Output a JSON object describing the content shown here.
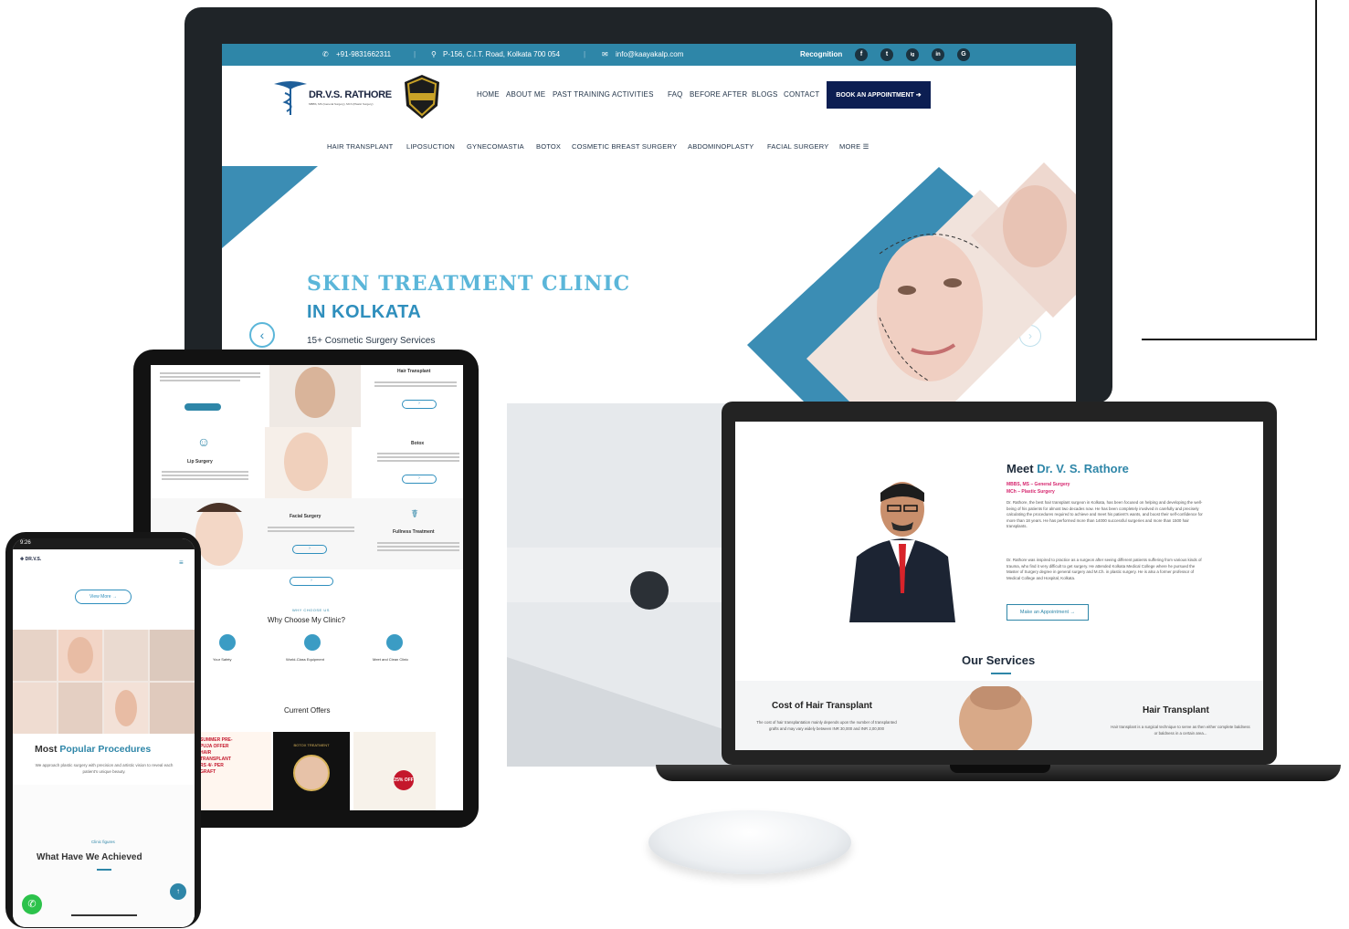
{
  "desktop": {
    "topbar": {
      "phone": "+91-9831662311",
      "address": "P-156, C.I.T. Road, Kolkata 700 054",
      "email": "info@kaayakalp.com",
      "recognition": "Recognition",
      "social": [
        "f",
        "t",
        "ig",
        "in",
        "G"
      ]
    },
    "logo": {
      "name": "DR.V.S. RATHORE",
      "tagline": "MBBS, MS (General Surgery), MCh (Plastic Surgery)"
    },
    "nav_primary": [
      "HOME",
      "ABOUT ME",
      "PAST TRAINING ACTIVITIES",
      "FAQ",
      "BEFORE AFTER",
      "BLOGS",
      "CONTACT"
    ],
    "book_button": "BOOK AN APPOINTMENT ➔",
    "nav_secondary": [
      "HAIR TRANSPLANT",
      "LIPOSUCTION",
      "GYNECOMASTIA",
      "BOTOX",
      "COSMETIC BREAST SURGERY",
      "ABDOMINOPLASTY",
      "FACIAL SURGERY",
      "MORE ☰"
    ],
    "hero": {
      "title_line1": "SKIN TREATMENT CLINIC",
      "title_line2": "IN KOLKATA",
      "subtitle": "15+ Cosmetic Surgery Services"
    },
    "accent": "#2e86a8"
  },
  "laptop": {
    "meet_prefix": "Meet ",
    "meet_name": "Dr. V. S. Rathore",
    "qual1": "MBBS, MS – General Surgery",
    "qual2": "MCh – Plastic Surgery",
    "bio1": "Dr. Rathore, the best hair transplant surgeon in Kolkata, has been focused on helping and developing the well-being of his patients for almost two decades now. He has been completely involved in carefully and precisely calculating the procedures required to achieve and meet his patient's wants, and boost their self-confidence for more than 18 years. He has performed more than 14000 successful surgeries and more than 1500 hair transplants.",
    "bio2": "Dr. Rathore was inspired to practice as a surgeon after seeing different patients suffering from various kinds of trauma, who find it very difficult to get surgery. He attended Kolkata Medical College where he pursued the Master of Surgery degree in general surgery and M.Ch. in plastic surgery. He is also a former professor of Medical College and Hospital, Kolkata.",
    "appointment_button": "Make an Appointment →",
    "services_heading": "Our Services",
    "service1_title": "Cost of Hair Transplant",
    "service1_text": "The cost of hair transplantation mainly depends upon the number of transplanted grafts and may vary widely between INR 30,000 and INR 2,00,000",
    "service2_title": "Hair Transplant",
    "service2_text": "Hair transplant is a surgical technique to serve as then either complete baldness or baldness in a certain area..."
  },
  "tablet": {
    "card1_title": "Hair Transplant",
    "card2_title": "Lip Surgery",
    "card3_title": "Botox",
    "card4_title": "Facial Surgery",
    "card5_title": "Fullness Treatment",
    "why_kicker": "WHY CHOOSE US",
    "why_heading": "Why Choose My Clinic?",
    "why_items": [
      "Your Safety",
      "World-Class Equipment",
      "Meet and Clean Clinic"
    ],
    "offers_heading": "Current Offers",
    "offer1_text": "SUMMER PRE-PUJA OFFER HAIR TRANSPLANT RS 4/- PER GRAFT",
    "offer2_text": "BOTOX TREATMENT",
    "offer3_text": "25% OFF"
  },
  "phone": {
    "status_time": "9:26",
    "view_more": "View More →",
    "most_popular_prefix": "Most ",
    "most_popular_highlight": "Popular Procedures",
    "most_popular_text": "We approach plastic surgery with precision and artistic vision to reveal each patient's unique beauty.",
    "clinic_figures": "Clinic figures",
    "achieved_heading": "What Have We Achieved"
  }
}
